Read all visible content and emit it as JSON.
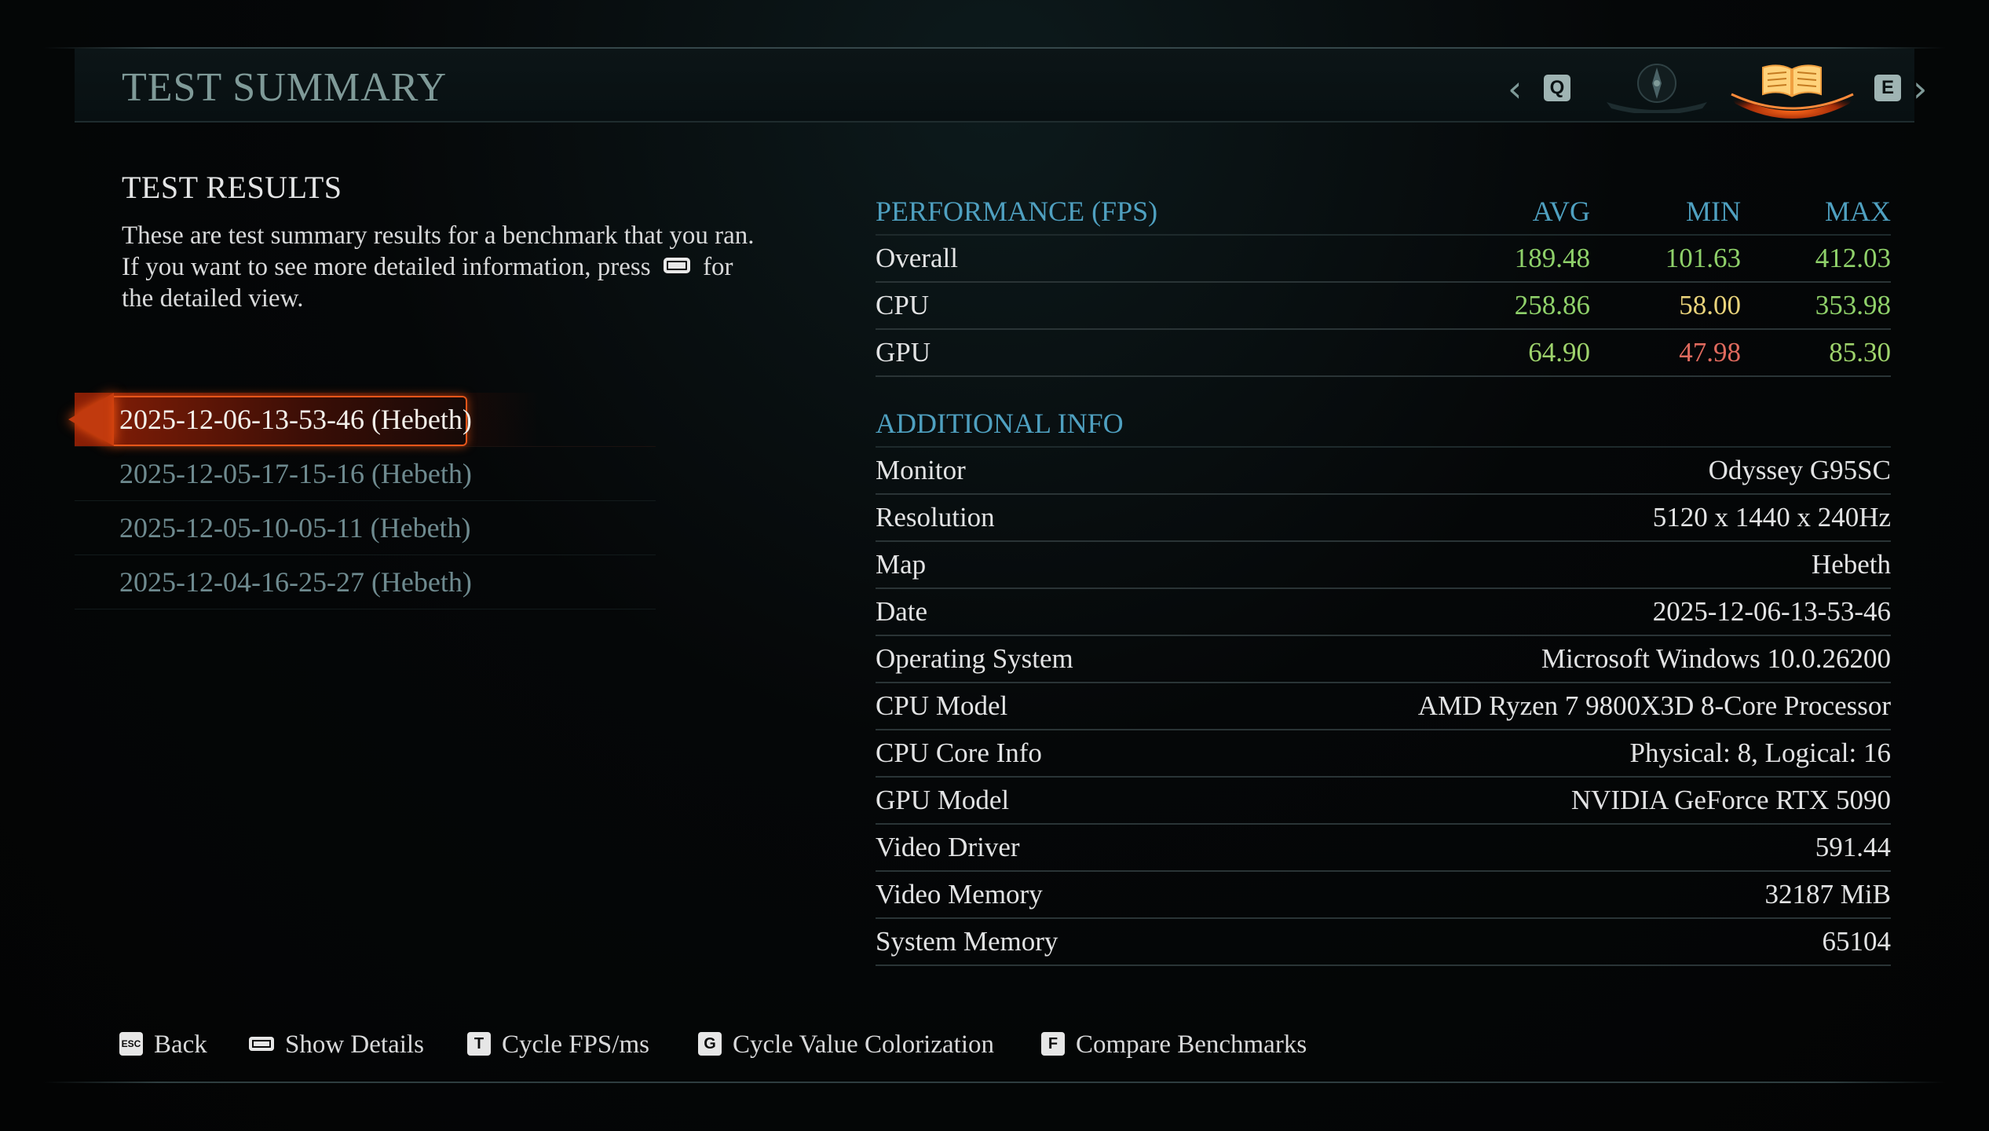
{
  "header": {
    "title": "TEST SUMMARY",
    "prev_key": "Q",
    "next_key": "E",
    "tabs": [
      {
        "icon": "compass-icon",
        "active": false
      },
      {
        "icon": "book-icon",
        "active": true
      }
    ]
  },
  "left": {
    "title": "TEST RESULTS",
    "description_before": "These are test summary results for a benchmark that you ran. If you want to see more detailed information, press",
    "description_after": "for the detailed view.",
    "benchmarks": [
      {
        "label": "2025-12-06-13-53-46 (Hebeth)",
        "selected": true
      },
      {
        "label": "2025-12-05-17-15-16 (Hebeth)",
        "selected": false
      },
      {
        "label": "2025-12-05-10-05-11 (Hebeth)",
        "selected": false
      },
      {
        "label": "2025-12-04-16-25-27 (Hebeth)",
        "selected": false
      }
    ]
  },
  "performance": {
    "header": "PERFORMANCE (FPS)",
    "col_avg": "AVG",
    "col_min": "MIN",
    "col_max": "MAX",
    "rows": [
      {
        "label": "Overall",
        "avg": "189.48",
        "min": "101.63",
        "max": "412.03",
        "avg_color": "#8fd16a",
        "min_color": "#8fd16a",
        "max_color": "#8fd16a"
      },
      {
        "label": "CPU",
        "avg": "258.86",
        "min": "58.00",
        "max": "353.98",
        "avg_color": "#8fd16a",
        "min_color": "#e8d27a",
        "max_color": "#8fd16a"
      },
      {
        "label": "GPU",
        "avg": "64.90",
        "min": "47.98",
        "max": "85.30",
        "avg_color": "#9ed36c",
        "min_color": "#e06a5e",
        "max_color": "#9ed36c"
      }
    ]
  },
  "additional": {
    "header": "ADDITIONAL INFO",
    "rows": [
      {
        "label": "Monitor",
        "value": "Odyssey G95SC"
      },
      {
        "label": "Resolution",
        "value": "5120 x 1440 x 240Hz"
      },
      {
        "label": "Map",
        "value": "Hebeth"
      },
      {
        "label": "Date",
        "value": "2025-12-06-13-53-46"
      },
      {
        "label": "Operating System",
        "value": "Microsoft Windows 10.0.26200"
      },
      {
        "label": "CPU Model",
        "value": "AMD Ryzen 7 9800X3D 8-Core Processor"
      },
      {
        "label": "CPU Core Info",
        "value": "Physical: 8, Logical: 16"
      },
      {
        "label": "GPU Model",
        "value": "NVIDIA GeForce RTX 5090"
      },
      {
        "label": "Video Driver",
        "value": "591.44"
      },
      {
        "label": "Video Memory",
        "value": "32187 MiB"
      },
      {
        "label": "System Memory",
        "value": "65104"
      }
    ]
  },
  "footer": {
    "back": {
      "key": "ESC",
      "label": "Back"
    },
    "details": {
      "key": "space",
      "label": "Show Details"
    },
    "cycle_fps": {
      "key": "T",
      "label": "Cycle FPS/ms"
    },
    "cycle_color": {
      "key": "G",
      "label": "Cycle Value Colorization"
    },
    "compare": {
      "key": "F",
      "label": "Compare Benchmarks"
    }
  },
  "colors": {
    "accent_teal": "#4fa0c0",
    "selected_orange": "#e6561a",
    "good_green": "#8fd16a",
    "warn_yellow": "#e8d27a",
    "bad_red": "#e06a5e"
  }
}
